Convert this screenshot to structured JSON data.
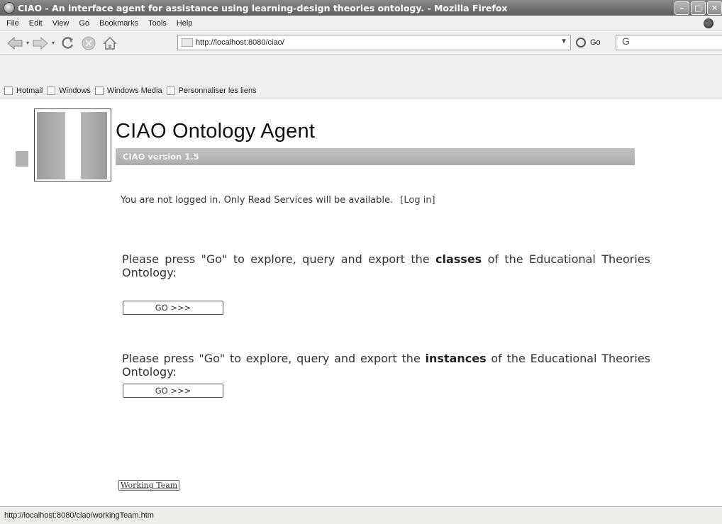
{
  "window": {
    "title": "CIAO - An interface agent for assistance using learning-design theories ontology. - Mozilla Firefox",
    "controls": {
      "minimize": "–",
      "maximize": "□",
      "close": "✕"
    }
  },
  "menubar": {
    "items": [
      "File",
      "Edit",
      "View",
      "Go",
      "Bookmarks",
      "Tools",
      "Help"
    ]
  },
  "navbar": {
    "url": "http://localhost:8080/ciao/",
    "go_label": "Go",
    "search_value": "G"
  },
  "bookmarks": {
    "items": [
      "Hotmail",
      "Windows",
      "Windows Media",
      "Personnaliser les liens"
    ]
  },
  "page": {
    "title": "CIAO Ontology Agent",
    "version": "CIAO version 1.5",
    "login_message": "You are not logged in. Only Read Services will be available.",
    "login_link": "[Log in]",
    "classes_prompt": {
      "prefix": "Please press \"Go\" to explore, query and export the ",
      "keyword": "classes",
      "suffix": " of the Educational Theories Ontology:"
    },
    "instances_prompt": {
      "prefix": "Please press \"Go\" to explore, query and export the ",
      "keyword": "instances",
      "suffix": " of the Educational Theories Ontology:"
    },
    "go_button_label": "GO >>>",
    "working_team_link": "Working Team"
  },
  "statusbar": {
    "text": "http://localhost:8080/ciao/workingTeam.htm"
  },
  "colors": {
    "title_bar": "#6e6e6e",
    "version_bar": "#b4b4b4",
    "chrome_bg": "#f0f0ee"
  },
  "icons": {
    "app": "firefox-icon",
    "back": "back-arrow-icon",
    "forward": "forward-arrow-icon",
    "reload": "reload-icon",
    "stop": "stop-icon",
    "home": "home-icon",
    "bookmark": "page-icon"
  }
}
